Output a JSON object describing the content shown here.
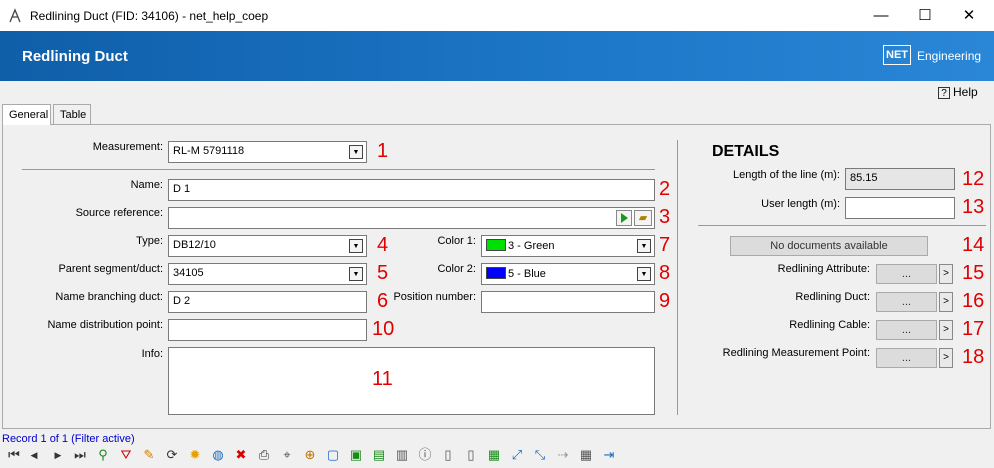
{
  "window": {
    "title": "Redlining Duct (FID: 34106) - net_help_coep",
    "minimize": "—",
    "maximize": "☐",
    "close": "✕"
  },
  "banner": {
    "title": "Redlining Duct",
    "logo": "NET",
    "brand": "Engineering"
  },
  "help": {
    "label": "Help"
  },
  "tabs": [
    {
      "label": "General"
    },
    {
      "label": "Table"
    }
  ],
  "form": {
    "measurement": {
      "label": "Measurement:",
      "value": "RL-M 5791118",
      "num": "1"
    },
    "name": {
      "label": "Name:",
      "value": "D 1",
      "num": "2"
    },
    "source_reference": {
      "label": "Source reference:",
      "value": "",
      "num": "3"
    },
    "type": {
      "label": "Type:",
      "value": "DB12/10",
      "num": "4"
    },
    "parent": {
      "label": "Parent segment/duct:",
      "value": "34105",
      "num": "5"
    },
    "branching": {
      "label": "Name branching duct:",
      "value": "D 2",
      "num": "6"
    },
    "distribution": {
      "label": "Name distribution point:",
      "value": "",
      "num": "10"
    },
    "info": {
      "label": "Info:",
      "value": "",
      "num": "11"
    },
    "color1": {
      "label": "Color 1:",
      "value": "3 - Green",
      "color": "#00e000",
      "num": "7"
    },
    "color2": {
      "label": "Color 2:",
      "value": "5 - Blue",
      "color": "#0000ff",
      "num": "8"
    },
    "position": {
      "label": "Position number:",
      "value": "",
      "num": "9"
    }
  },
  "details": {
    "heading": "DETAILS",
    "length": {
      "label": "Length of the line (m):",
      "value": "85.15",
      "num": "12"
    },
    "user_length": {
      "label": "User length (m):",
      "value": "",
      "num": "13"
    },
    "documents": {
      "label": "No documents available",
      "num": "14"
    },
    "attr": {
      "label": "Redlining Attribute:",
      "btn": "...",
      "arrow": ">",
      "num": "15"
    },
    "duct": {
      "label": "Redlining Duct:",
      "btn": "...",
      "arrow": ">",
      "num": "16"
    },
    "cable": {
      "label": "Redlining Cable:",
      "btn": "...",
      "arrow": ">",
      "num": "17"
    },
    "mpoint": {
      "label": "Redlining Measurement Point:",
      "btn": "...",
      "arrow": ">",
      "num": "18"
    }
  },
  "status": {
    "record": "Record 1 of 1 (Filter active)"
  },
  "toolbar": {
    "first": "⏮",
    "prev": "◀",
    "next": "▶",
    "last": "⏭",
    "filter_add": "⚲",
    "filter": "⛛",
    "edit": "✎",
    "refresh": "⟳",
    "highlight": "✹",
    "globe": "◍",
    "delete": "✖",
    "print": "⎙",
    "select": "⌖",
    "zoom": "⊕",
    "frame": "▢",
    "layer1": "▣",
    "layer2": "▤",
    "layer3": "▥",
    "info": "ⓘ",
    "doc1": "▯",
    "doc2": "▯",
    "image": "▦",
    "link1": "⤢",
    "link2": "⤡",
    "link3": "⇢",
    "table": "▦",
    "exit": "⇥"
  }
}
